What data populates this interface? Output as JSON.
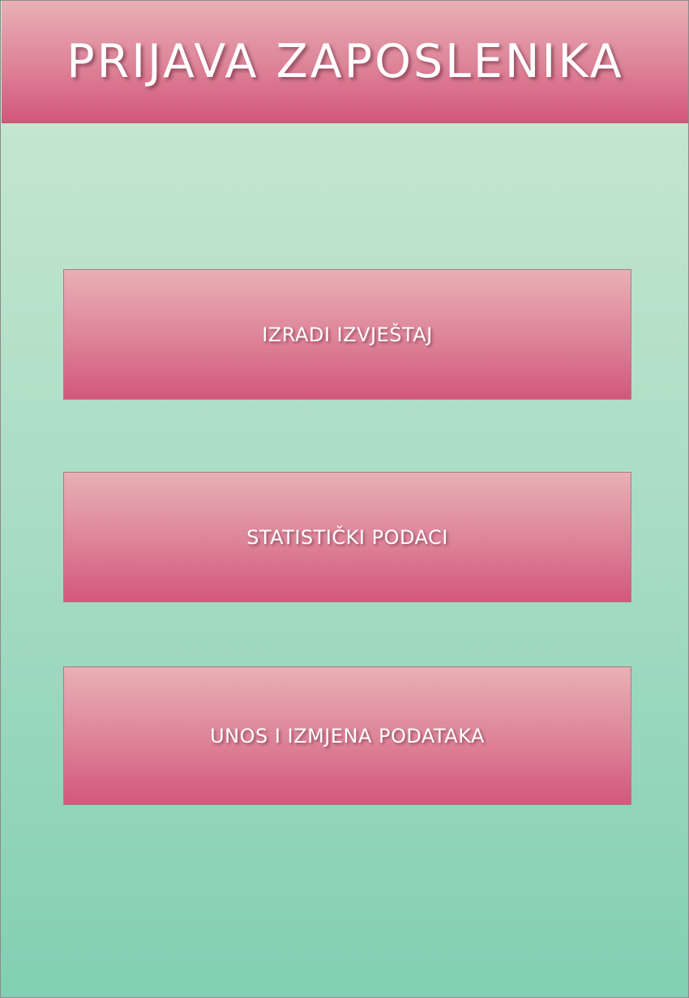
{
  "header": {
    "title": "PRIJAVA ZAPOSLENIKA"
  },
  "menu": {
    "buttons": [
      {
        "label": "IZRADI IZVJEŠTAJ"
      },
      {
        "label": "STATISTIČKI PODACI"
      },
      {
        "label": "UNOS I IZMJENA PODATAKA"
      }
    ]
  },
  "colors": {
    "header_gradient_top": "#e8b0b5",
    "header_gradient_bottom": "#d3577a",
    "background_gradient_top": "#cde8d2",
    "background_gradient_bottom": "#82cfb4",
    "text": "#ffffff"
  }
}
